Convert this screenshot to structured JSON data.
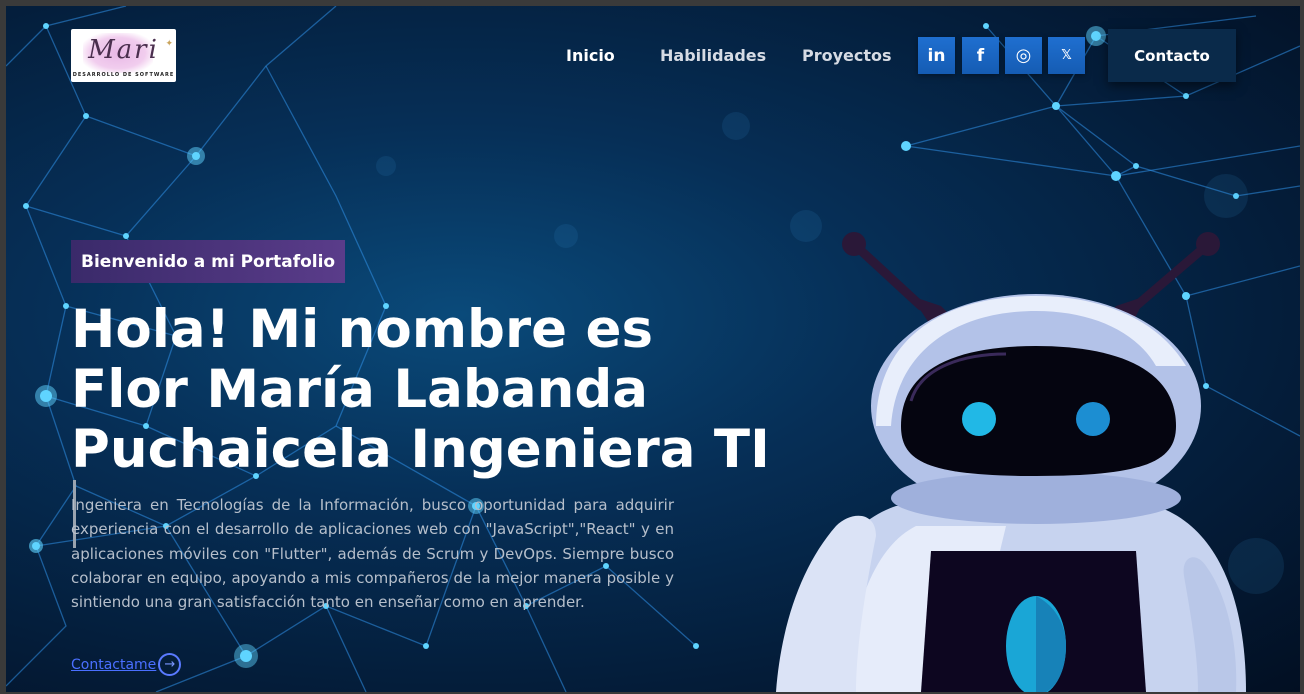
{
  "nav": {
    "logo": {
      "name": "Mari",
      "subtitle": "DESARROLLO DE SOFTWARE"
    },
    "links": [
      "Inicio",
      "Habilidades",
      "Proyectos"
    ],
    "social": [
      {
        "icon": "linkedin-icon",
        "glyph": "in"
      },
      {
        "icon": "facebook-icon",
        "glyph": "f"
      },
      {
        "icon": "instagram-icon",
        "glyph": "◎"
      },
      {
        "icon": "x-icon",
        "glyph": "𝕏"
      }
    ],
    "contact_label": "Contacto"
  },
  "hero": {
    "badge": "Bienvenido a mi Portafolio",
    "headline": "Hola! Mi nombre es Flor María Labanda Puchaicela Ingeniera TI",
    "description": "Ingeniera en Tecnologías de la Información, busco oportunidad para adquirir experiencia con el desarrollo de aplicaciones web con \"JavaScript\",\"React\" y en aplicaciones móviles con \"Flutter\", además de Scrum y DevOps. Siempre busco colaborar en equipo, apoyando a mis compañeros de la mejor manera posible y sintiendo una gran satisfacción tanto en enseñar como en aprender.",
    "cta_label": "Contactame",
    "cta_icon": "arrow-right-circle-icon"
  },
  "colors": {
    "accent": "#1f6fd0",
    "badge": "#4a3478",
    "link": "#4a6fff",
    "background": "#062f57"
  }
}
